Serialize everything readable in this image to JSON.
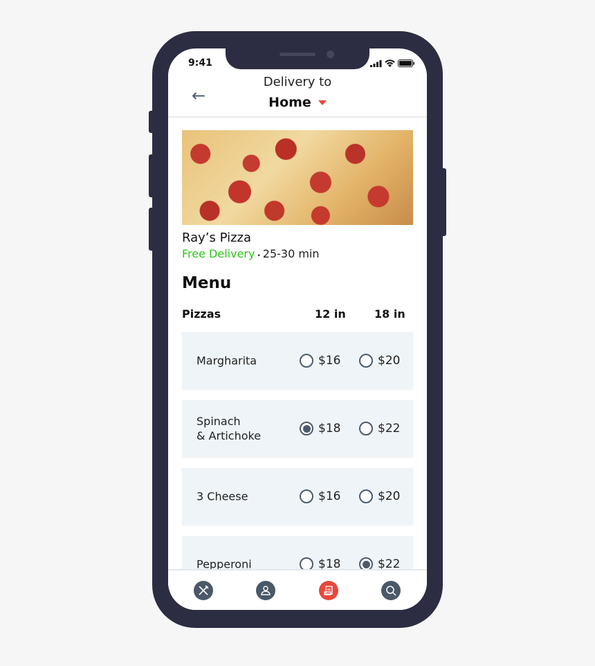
{
  "status": {
    "time": "9:41"
  },
  "header": {
    "title": "Delivery to",
    "location": "Home"
  },
  "restaurant": {
    "name": "Ray’s Pizza",
    "delivery": "Free Delivery",
    "separator": "•",
    "eta": "25-30 min"
  },
  "menu": {
    "title": "Menu",
    "category": "Pizzas",
    "sizes": [
      "12 in",
      "18 in"
    ],
    "items": [
      {
        "name": "Margharita",
        "prices": [
          "$16",
          "$20"
        ],
        "selected": null
      },
      {
        "name": "Spinach\n& Artichoke",
        "prices": [
          "$18",
          "$22"
        ],
        "selected": 0
      },
      {
        "name": "3 Cheese",
        "prices": [
          "$16",
          "$20"
        ],
        "selected": null
      },
      {
        "name": "Pepperoni",
        "prices": [
          "$18",
          "$22"
        ],
        "selected": 1
      }
    ]
  },
  "nav": {
    "items": [
      {
        "icon": "utensils-icon"
      },
      {
        "icon": "user-icon"
      },
      {
        "icon": "order-icon",
        "active": true
      },
      {
        "icon": "search-icon"
      }
    ]
  },
  "colors": {
    "accent": "#e8483b",
    "free": "#2ec31a",
    "frame": "#2c2d42",
    "card": "#eff4f9"
  }
}
